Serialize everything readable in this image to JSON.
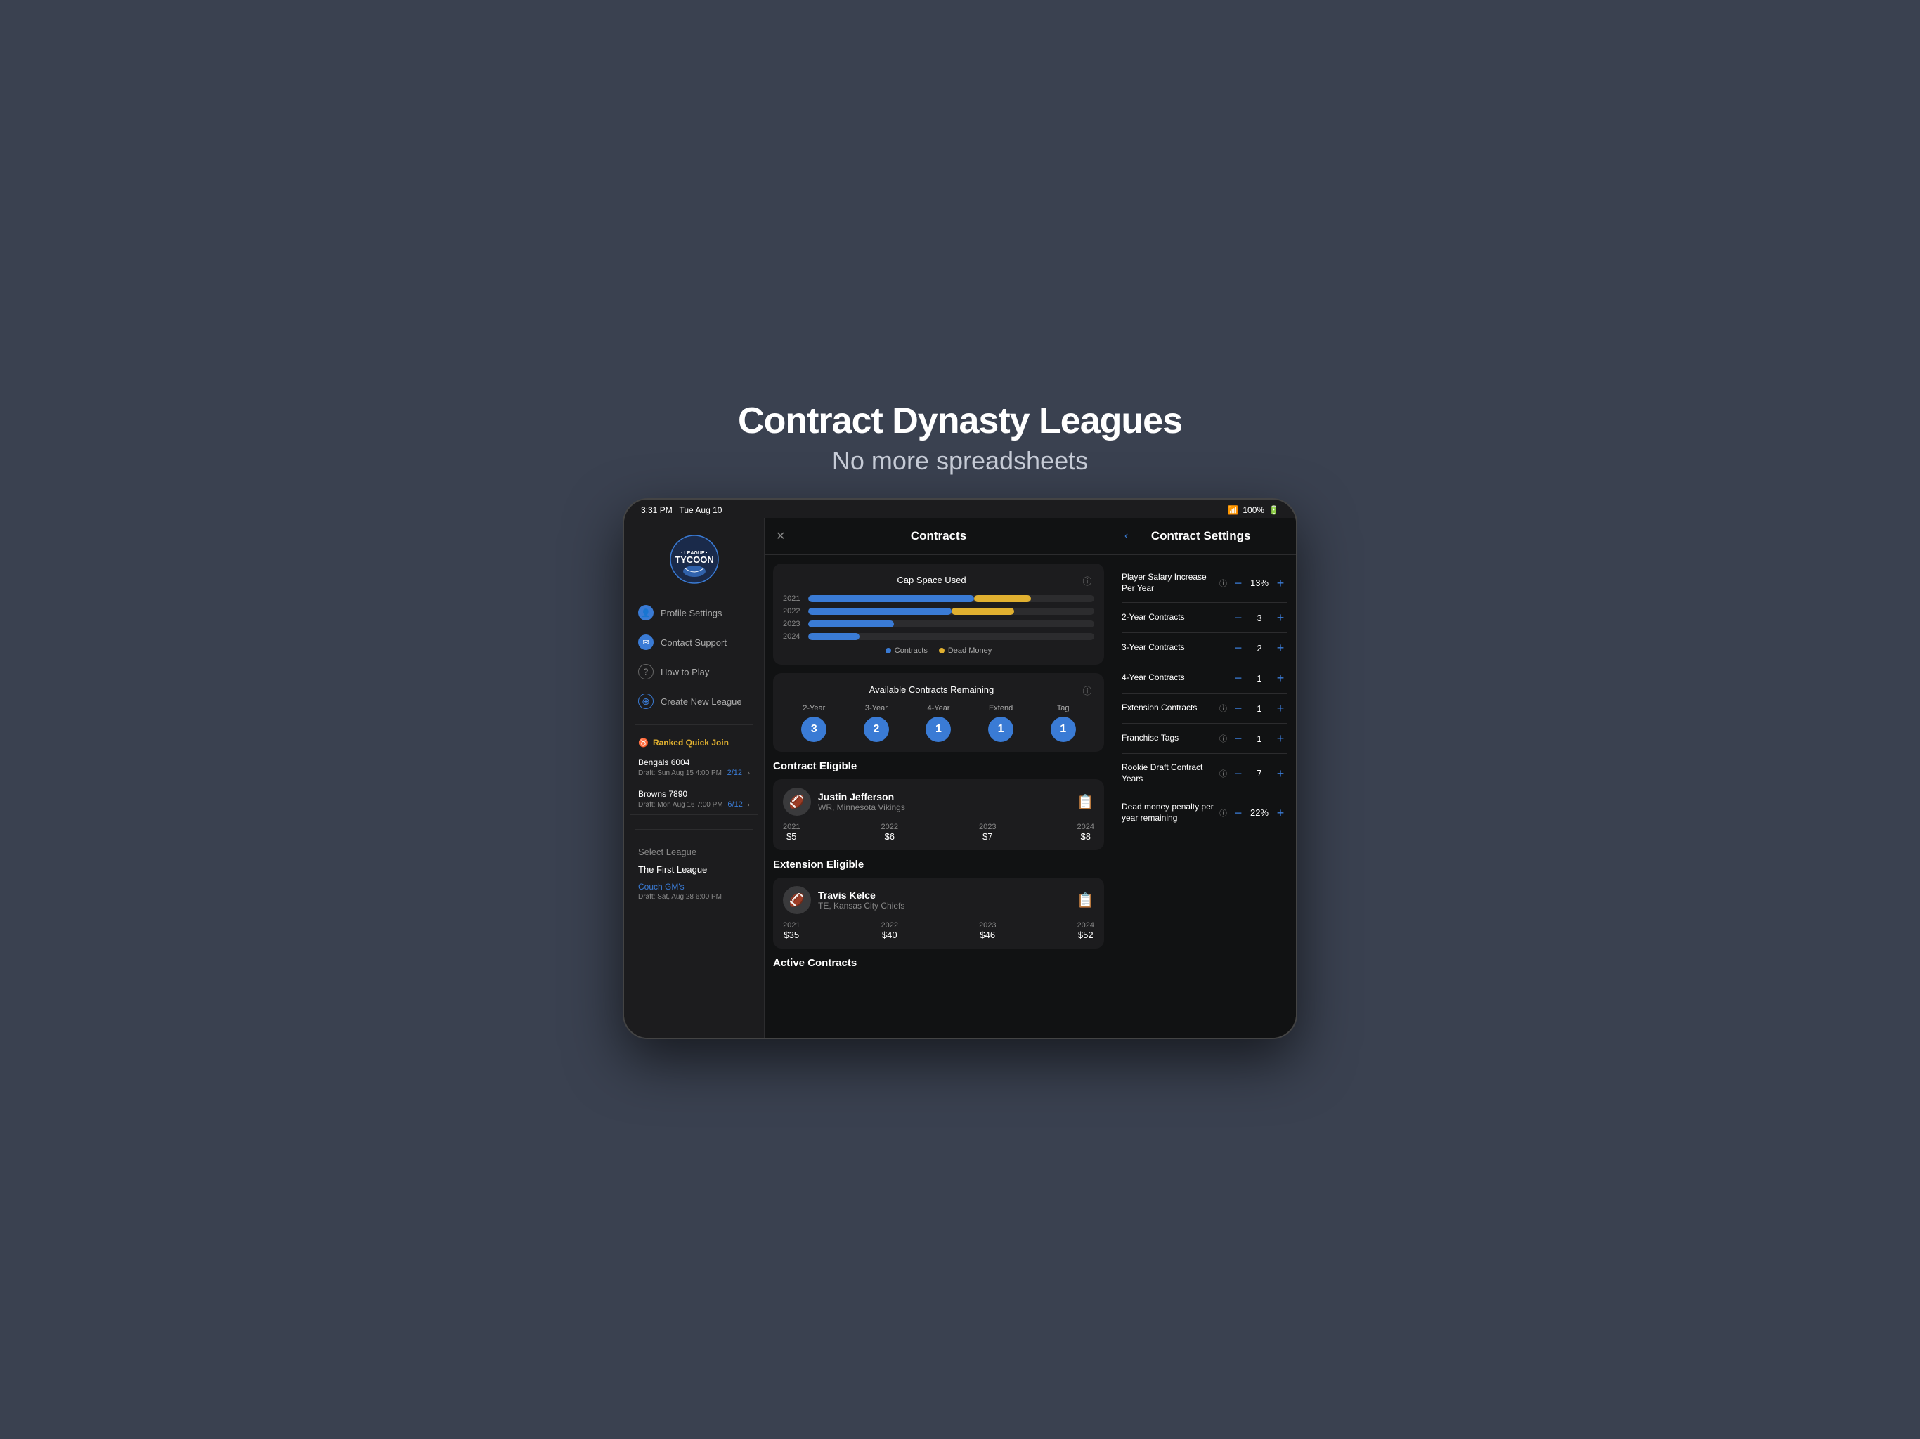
{
  "page": {
    "title": "Contract Dynasty Leagues",
    "subtitle": "No more spreadsheets"
  },
  "status_bar": {
    "time": "3:31 PM",
    "date": "Tue Aug 10",
    "battery": "100%"
  },
  "sidebar": {
    "nav_items": [
      {
        "id": "profile",
        "label": "Profile Settings",
        "icon": "👤"
      },
      {
        "id": "support",
        "label": "Contact Support",
        "icon": "✉"
      },
      {
        "id": "howto",
        "label": "How to Play",
        "icon": "?"
      },
      {
        "id": "create",
        "label": "Create New League",
        "icon": "+"
      }
    ],
    "ranked_header": "Ranked Quick Join",
    "ranked_items": [
      {
        "name": "Bengals 6004",
        "draft": "Draft: Sun Aug 15  4:00 PM",
        "count": "2/12"
      },
      {
        "name": "Browns 7890",
        "draft": "Draft: Mon Aug 16  7:00 PM",
        "count": "6/12"
      }
    ],
    "select_league_label": "Select League",
    "league_name": "The First League",
    "couch_gm": "Couch GM's",
    "couch_gm_draft": "Draft: Sat, Aug 28  6:00 PM"
  },
  "middle_panel": {
    "title": "Contracts",
    "cap_space": {
      "title": "Cap Space Used",
      "years": [
        {
          "year": "2021",
          "contracts_pct": 58,
          "dead_pct": 20
        },
        {
          "year": "2022",
          "contracts_pct": 50,
          "dead_pct": 22
        },
        {
          "year": "2023",
          "contracts_pct": 30,
          "dead_pct": 0
        },
        {
          "year": "2024",
          "contracts_pct": 18,
          "dead_pct": 0
        }
      ],
      "legend_contracts": "Contracts",
      "legend_dead": "Dead Money"
    },
    "available_contracts": {
      "title": "Available Contracts Remaining",
      "cols": [
        {
          "label": "2-Year",
          "value": "3"
        },
        {
          "label": "3-Year",
          "value": "2"
        },
        {
          "label": "4-Year",
          "value": "1"
        },
        {
          "label": "Extend",
          "value": "1"
        },
        {
          "label": "Tag",
          "value": "1"
        }
      ]
    },
    "contract_eligible_label": "Contract Eligible",
    "players_contract": [
      {
        "name": "Justin Jefferson",
        "pos": "WR, Minnesota Vikings",
        "avatar": "🏈",
        "years": [
          {
            "year": "2021",
            "val": "$5"
          },
          {
            "year": "2022",
            "val": "$6"
          },
          {
            "year": "2023",
            "val": "$7"
          },
          {
            "year": "2024",
            "val": "$8"
          }
        ]
      }
    ],
    "extension_eligible_label": "Extension Eligible",
    "players_extension": [
      {
        "name": "Travis Kelce",
        "pos": "TE, Kansas City Chiefs",
        "avatar": "🏈",
        "years": [
          {
            "year": "2021",
            "val": "$35"
          },
          {
            "year": "2022",
            "val": "$40"
          },
          {
            "year": "2023",
            "val": "$46"
          },
          {
            "year": "2024",
            "val": "$52"
          }
        ]
      }
    ],
    "active_contracts_label": "Active Contracts"
  },
  "right_panel": {
    "title": "Contract Settings",
    "settings": [
      {
        "id": "salary-increase",
        "label": "Player Salary Increase Per Year",
        "has_info": true,
        "value": "13%"
      },
      {
        "id": "two-year",
        "label": "2-Year Contracts",
        "has_info": false,
        "value": "3"
      },
      {
        "id": "three-year",
        "label": "3-Year Contracts",
        "has_info": false,
        "value": "2"
      },
      {
        "id": "four-year",
        "label": "4-Year Contracts",
        "has_info": false,
        "value": "1"
      },
      {
        "id": "extension",
        "label": "Extension Contracts",
        "has_info": true,
        "value": "1"
      },
      {
        "id": "franchise",
        "label": "Franchise Tags",
        "has_info": true,
        "value": "1"
      },
      {
        "id": "rookie-draft",
        "label": "Rookie Draft Contract Years",
        "has_info": true,
        "value": "7"
      },
      {
        "id": "dead-money",
        "label": "Dead money penalty per year remaining",
        "has_info": true,
        "value": "22%"
      }
    ],
    "minus_label": "−",
    "plus_label": "+"
  }
}
